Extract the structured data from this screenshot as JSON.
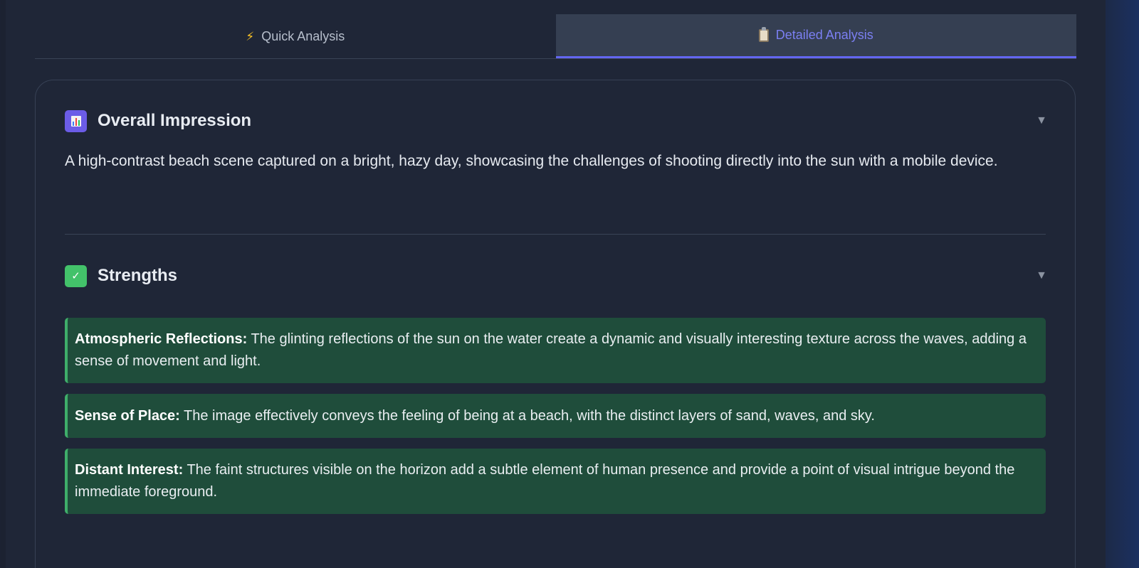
{
  "tabs": [
    {
      "label": "Quick Analysis",
      "icon": "lightning-icon",
      "active": false
    },
    {
      "label": "Detailed Analysis",
      "icon": "clipboard-icon",
      "active": true
    }
  ],
  "sections": {
    "overall": {
      "title": "Overall Impression",
      "icon": "bar-chart-icon",
      "text": "A high-contrast beach scene captured on a bright, hazy day, showcasing the challenges of shooting directly into the sun with a mobile device."
    },
    "strengths": {
      "title": "Strengths",
      "icon": "check-mark-icon",
      "items": [
        {
          "label": "Atmospheric Reflections:",
          "text": " The glinting reflections of the sun on the water create a dynamic and visually interesting texture across the waves, adding a sense of movement and light."
        },
        {
          "label": "Sense of Place:",
          "text": " The image effectively conveys the feeling of being at a beach, with the distinct layers of sand, waves, and sky."
        },
        {
          "label": "Distant Interest:",
          "text": " The faint structures visible on the horizon add a subtle element of human presence and provide a point of visual intrigue beyond the immediate foreground."
        }
      ]
    }
  },
  "colors": {
    "accent": "#6366f1",
    "strength_bg": "#1f4d3b",
    "strength_border": "#3fae6a"
  }
}
